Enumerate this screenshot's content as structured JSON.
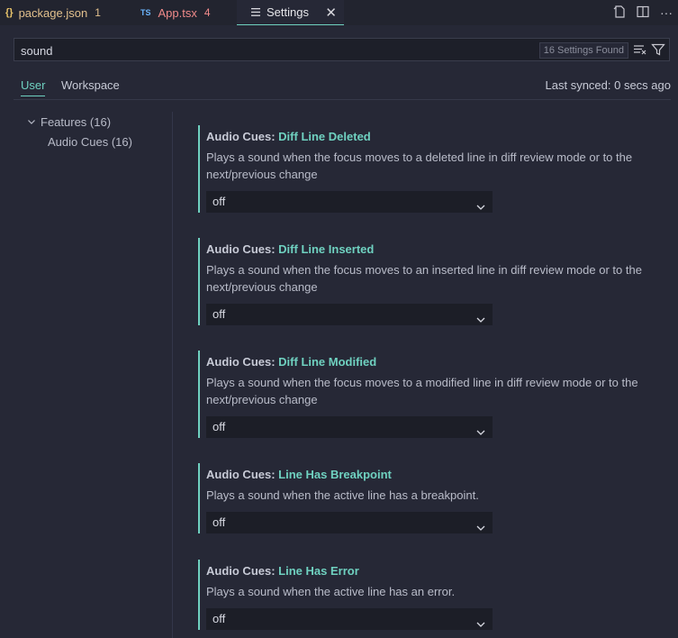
{
  "tabs": [
    {
      "icon": "json-braces-icon",
      "glyph": "{}",
      "label": "package.json",
      "problems": "1"
    },
    {
      "icon": "typescript-icon",
      "glyph": "TS",
      "label": "App.tsx",
      "problems": "4"
    },
    {
      "icon": "settings-icon",
      "label": "Settings",
      "active": true
    }
  ],
  "search": {
    "value": "sound",
    "count_label": "16 Settings Found"
  },
  "scope": {
    "user": "User",
    "workspace": "Workspace",
    "synced": "Last synced: 0 secs ago"
  },
  "toc": {
    "features": "Features (16)",
    "audio_cues": "Audio Cues (16)"
  },
  "settings": [
    {
      "prefix": "Audio Cues: ",
      "name": "Diff Line Deleted",
      "description": "Plays a sound when the focus moves to a deleted line in diff review mode or to the next/previous change",
      "value": "off"
    },
    {
      "prefix": "Audio Cues: ",
      "name": "Diff Line Inserted",
      "description": "Plays a sound when the focus moves to an inserted line in diff review mode or to the next/previous change",
      "value": "off"
    },
    {
      "prefix": "Audio Cues: ",
      "name": "Diff Line Modified",
      "description": "Plays a sound when the focus moves to a modified line in diff review mode or to the next/previous change",
      "value": "off"
    },
    {
      "prefix": "Audio Cues: ",
      "name": "Line Has Breakpoint",
      "description": "Plays a sound when the active line has a breakpoint.",
      "value": "off"
    },
    {
      "prefix": "Audio Cues: ",
      "name": "Line Has Error",
      "description": "Plays a sound when the active line has an error.",
      "value": "off"
    }
  ],
  "colors": {
    "accent": "#6fd1c0",
    "background": "#262836",
    "tab_bar": "#22242f",
    "warning_text": "#e2c08d",
    "error_text": "#f08a8a"
  }
}
